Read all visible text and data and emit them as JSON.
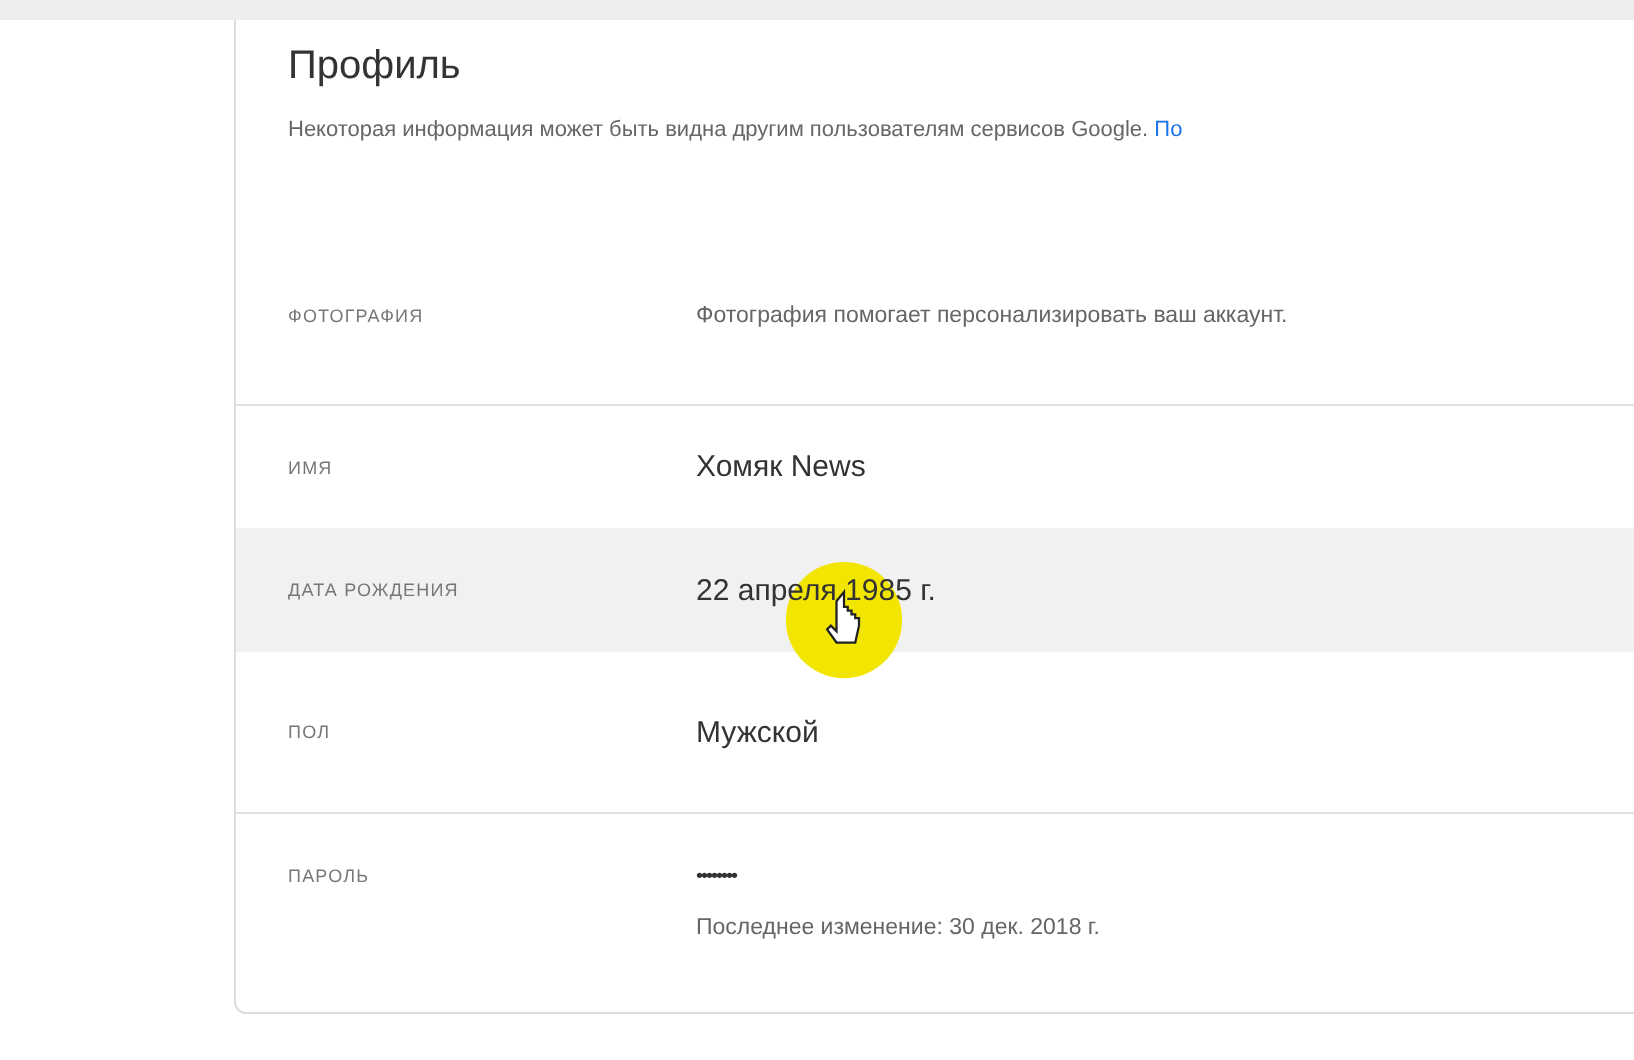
{
  "profile": {
    "title": "Профиль",
    "subtitle": "Некоторая информация может быть видна другим пользователям сервисов Google.",
    "link": "По",
    "rows": [
      {
        "kind": "photo",
        "label": "ФОТОГРАФИЯ",
        "value": "Фотография помогает персонализировать ваш аккаунт.",
        "highlighted": false
      },
      {
        "kind": "text",
        "label": "ИМЯ",
        "value": "Хомяк News",
        "highlighted": false
      },
      {
        "kind": "text",
        "label": "ДАТА РОЖДЕНИЯ",
        "value": "22 апреля 1985 г.",
        "highlighted": true
      },
      {
        "kind": "text",
        "label": "ПОЛ",
        "value": "Мужской",
        "highlighted": false
      },
      {
        "kind": "password",
        "label": "ПАРОЛЬ",
        "value": "••••••••",
        "note": "Последнее изменение: 30 дек. 2018 г.",
        "highlighted": false
      }
    ]
  }
}
